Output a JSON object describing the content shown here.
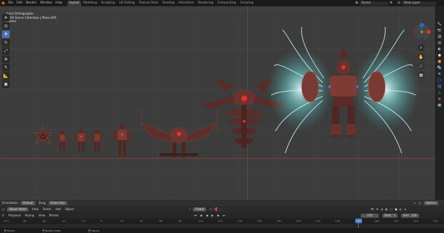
{
  "menu": [
    "File",
    "Edit",
    "Render",
    "Window",
    "Help"
  ],
  "workspace_tabs": [
    "Layout",
    "Modeling",
    "Sculpting",
    "UV Editing",
    "Texture Paint",
    "Shading",
    "Animation",
    "Rendering",
    "Compositing",
    "Scripting"
  ],
  "active_tab": "Layout",
  "scene": {
    "label": "Scene",
    "view_layer": "View Layer"
  },
  "viewport": {
    "header_items": [
      "View",
      "Select",
      "Add",
      "Object"
    ],
    "overlay_title": "Front Orthographic",
    "overlay_collection": "(250) Scene Collection | Plane.005",
    "overlay_units": "Meters"
  },
  "toolbar_tools": [
    "cursor-select",
    "cursor-3d",
    "move",
    "rotate",
    "scale",
    "transform",
    "annotate",
    "measure",
    "add-cube"
  ],
  "bottom_bar": {
    "orientation_label": "Orientation:",
    "orientation_value": "Default",
    "drag_label": "Drag:",
    "drag_value": "Select Box",
    "options_label": "Options"
  },
  "mode_bar": {
    "mode": "Object Mode",
    "items": [
      "View",
      "Select",
      "Add",
      "Object"
    ],
    "transform": "Global"
  },
  "timeline": {
    "items": [
      "Playback",
      "Keying",
      "View",
      "Marker"
    ],
    "current_frame": "250",
    "start_label": "Start",
    "start_value": "1",
    "end_label": "End",
    "end_value": "250",
    "ruler": [
      "-100",
      "-80",
      "-60",
      "-40",
      "-20",
      "0",
      "20",
      "40",
      "60",
      "80",
      "100",
      "120",
      "140",
      "160",
      "180",
      "200",
      "220",
      "240",
      "260",
      "280",
      "300",
      "320",
      "330"
    ]
  },
  "statusbar": [
    "Select",
    "Rotate View",
    "Object"
  ],
  "colors": {
    "accent": "#4772b3",
    "brand": "#e87d0d"
  }
}
